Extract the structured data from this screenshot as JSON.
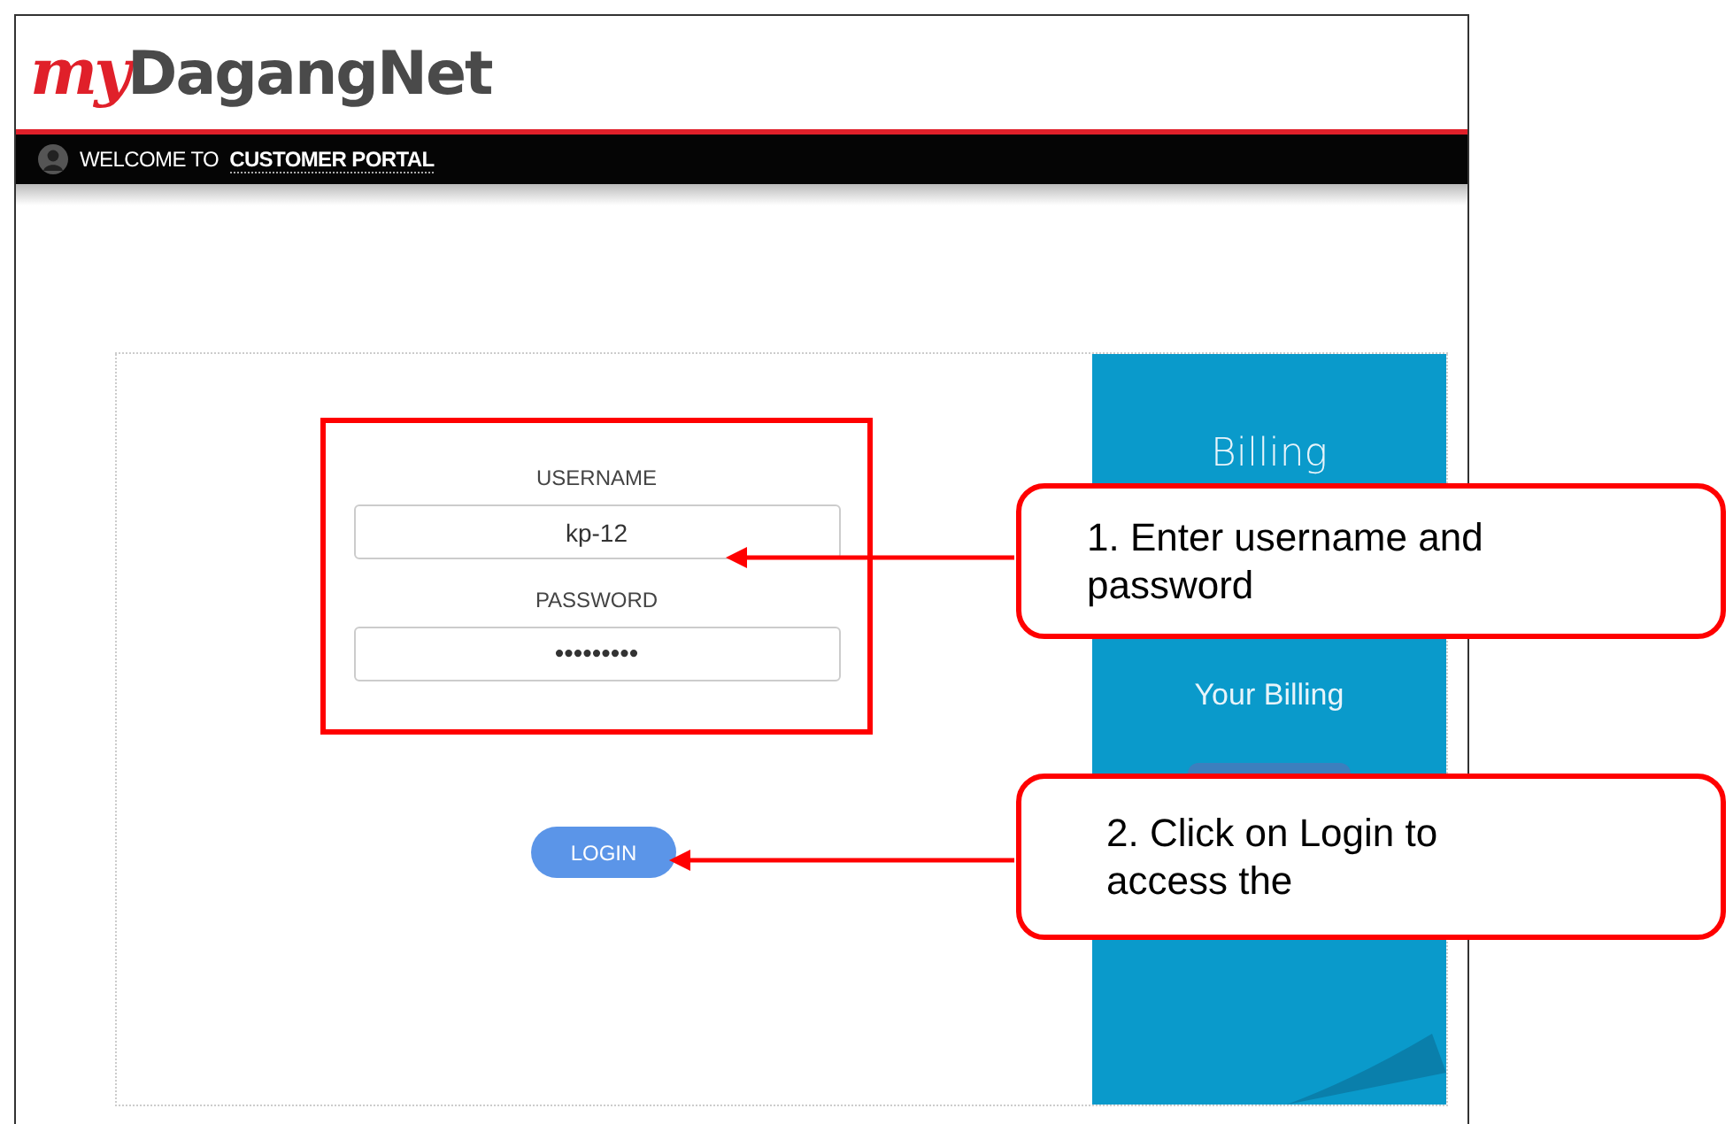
{
  "header": {
    "logo_script": "my",
    "logo_text": "DagangNet"
  },
  "welcome_bar": {
    "prefix": "WELCOME TO",
    "portal": "CUSTOMER PORTAL"
  },
  "login_form": {
    "username_label": "USERNAME",
    "username_value": "kp-12",
    "password_label": "PASSWORD",
    "password_value": "•••••••••",
    "login_button": "LOGIN"
  },
  "promo_panel": {
    "title": "Billing",
    "subtitle": "Your Billing"
  },
  "callouts": [
    {
      "text": "1. Enter username and password"
    },
    {
      "text": "2. Click on Login to access the"
    }
  ]
}
